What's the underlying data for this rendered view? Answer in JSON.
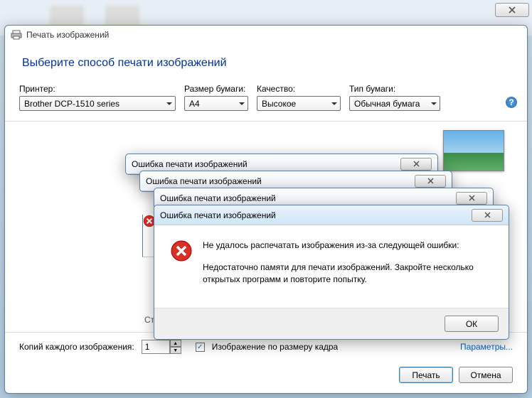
{
  "window": {
    "title": "Печать изображений",
    "header": "Выберите способ печати изображений"
  },
  "options": {
    "printer": {
      "label": "Принтер:",
      "value": "Brother DCP-1510 series"
    },
    "paper_size": {
      "label": "Размер бумаги:",
      "value": "A4"
    },
    "quality": {
      "label": "Качество:",
      "value": "Высокое"
    },
    "paper_type": {
      "label": "Тип бумаги:",
      "value": "Обычная бумага"
    }
  },
  "page_label": "Стран",
  "copies": {
    "label": "Копий каждого изображения:",
    "value": "1",
    "checkbox_label": "Изображение по размеру кадра",
    "checked": "✓"
  },
  "link_options": "Параметры...",
  "footer": {
    "print": "Печать",
    "cancel": "Отмена"
  },
  "error": {
    "title": "Ошибка печати изображений",
    "message": "Не удалось распечатать изображения из-за следующей ошибки:",
    "detail": "Недостаточно памяти для печати изображений. Закройте несколько открытых программ и повторите попытку.",
    "ok": "ОК"
  },
  "help": "?"
}
